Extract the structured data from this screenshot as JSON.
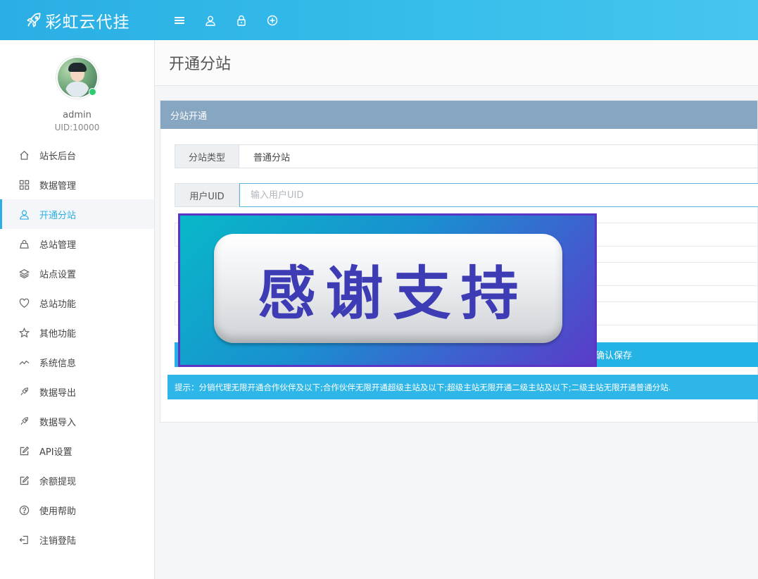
{
  "app": {
    "brand": "彩虹云代挂",
    "accent_color": "#2aaee4",
    "top_icons": [
      "menu-icon",
      "user-icon",
      "lock-icon",
      "plus-circle-icon"
    ]
  },
  "profile": {
    "username": "admin",
    "uid": "UID:10000",
    "status": "online"
  },
  "sidebar": {
    "items": [
      {
        "label": "站长后台",
        "icon": "home-icon"
      },
      {
        "label": "数据管理",
        "icon": "grid-icon"
      },
      {
        "label": "开通分站",
        "icon": "user-icon",
        "active": true
      },
      {
        "label": "总站管理",
        "icon": "bag-icon"
      },
      {
        "label": "站点设置",
        "icon": "layers-icon"
      },
      {
        "label": "总站功能",
        "icon": "heart-icon"
      },
      {
        "label": "其他功能",
        "icon": "star-icon"
      },
      {
        "label": "系统信息",
        "icon": "trend-icon"
      },
      {
        "label": "数据导出",
        "icon": "rocket-icon"
      },
      {
        "label": "数据导入",
        "icon": "rocket-icon"
      },
      {
        "label": "API设置",
        "icon": "edit-icon"
      },
      {
        "label": "余额提现",
        "icon": "edit-icon"
      },
      {
        "label": "使用帮助",
        "icon": "help-icon"
      },
      {
        "label": "注销登陆",
        "icon": "logout-icon"
      }
    ]
  },
  "page": {
    "title": "开通分站"
  },
  "panel": {
    "title": "分站开通",
    "type_label": "分站类型",
    "type_value": "普通分站",
    "uid_label": "用户UID",
    "uid_placeholder": "输入用户UID",
    "uid_value": "",
    "save_label": "确认保存",
    "tip": "提示：分销代理无限开通合作伙伴及以下;合作伙伴无限开通超级主站及以下;超级主站无限开通二级主站及以下;二级主站无限开通普通分站."
  },
  "overlay": {
    "text": "感谢支持"
  }
}
